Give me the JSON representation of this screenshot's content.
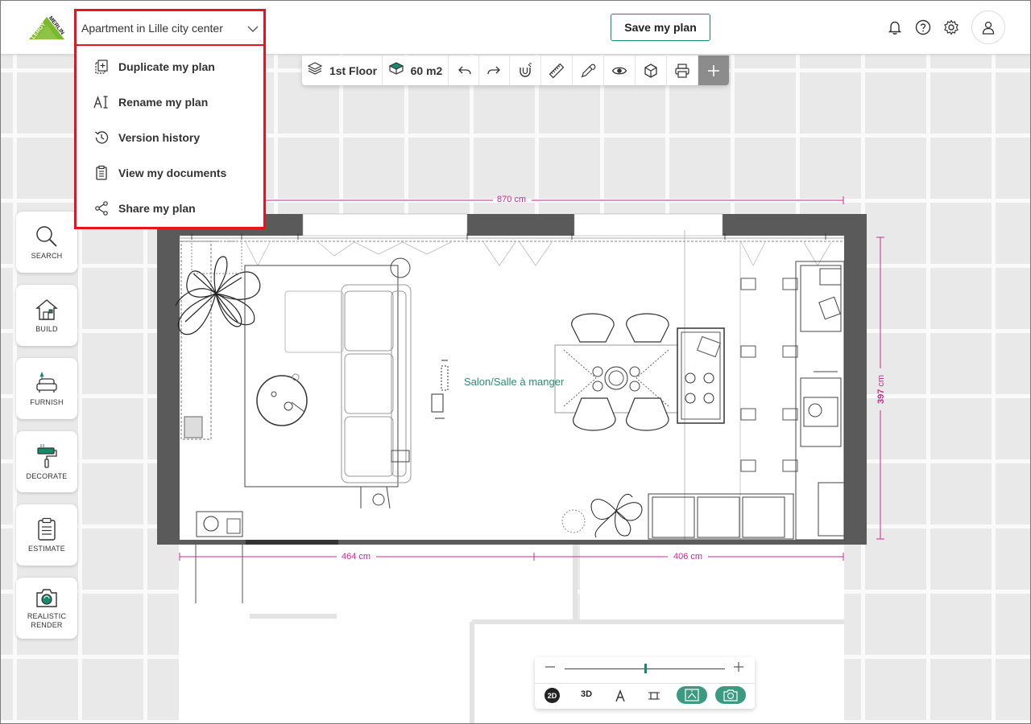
{
  "header": {
    "plan_title": "Apartment in Lille city center",
    "save_label": "Save my plan",
    "logo_text_1": "LEROY",
    "logo_text_2": "MERLIN"
  },
  "plan_menu": {
    "items": [
      {
        "label": "Duplicate my plan",
        "icon": "duplicate-icon"
      },
      {
        "label": "Rename my plan",
        "icon": "rename-icon"
      },
      {
        "label": "Version history",
        "icon": "history-icon"
      },
      {
        "label": "View my documents",
        "icon": "documents-icon"
      },
      {
        "label": "Share my plan",
        "icon": "share-icon"
      }
    ]
  },
  "toolbar": {
    "floor_label": "1st Floor",
    "area_label": "60 m2"
  },
  "side_menu": {
    "items": [
      {
        "label": "SEARCH"
      },
      {
        "label": "BUILD"
      },
      {
        "label": "FURNISH"
      },
      {
        "label": "DECORATE"
      },
      {
        "label": "ESTIMATE"
      },
      {
        "label": "REALISTIC RENDER"
      }
    ]
  },
  "plan": {
    "room_label": "Salon/Salle à manger",
    "dim_top_value": "870",
    "dim_bottom_left_value": "464",
    "dim_bottom_right_value": "406",
    "dim_right_value": "397",
    "unit": "cm"
  },
  "view_controls": {
    "mode_2d": "2D",
    "mode_3d": "3D",
    "zoom_level": 0.5
  },
  "colors": {
    "accent": "#188a6c",
    "highlight": "#e5141e",
    "dimension": "#cc2a8f",
    "room_label": "#2e8b6e"
  }
}
